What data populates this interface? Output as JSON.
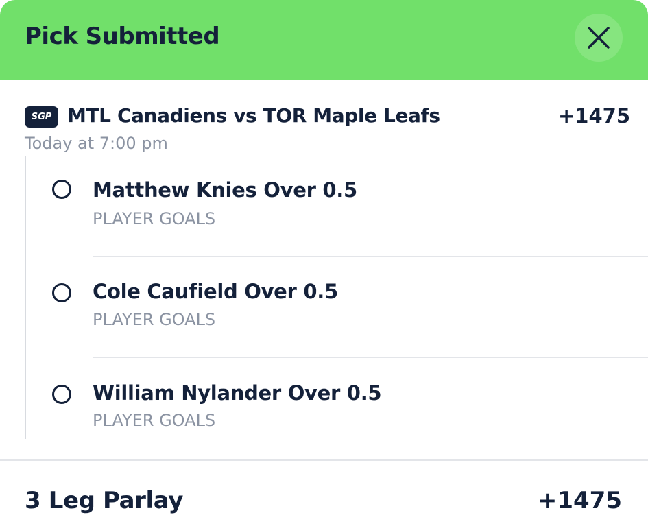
{
  "header": {
    "title": "Pick Submitted",
    "close_icon": "close-icon",
    "background_color": "#71e06a"
  },
  "game": {
    "badge": "SGP",
    "matchup": "MTL Canadiens vs TOR Maple Leafs",
    "odds": "+1475",
    "time": "Today at 7:00 pm"
  },
  "legs": [
    {
      "title": "Matthew Knies Over 0.5",
      "market": "PLAYER GOALS"
    },
    {
      "title": "Cole Caufield Over 0.5",
      "market": "PLAYER GOALS"
    },
    {
      "title": "William Nylander Over 0.5",
      "market": "PLAYER GOALS"
    }
  ],
  "parlay": {
    "label": "3 Leg Parlay",
    "odds": "+1475"
  },
  "colors": {
    "text_primary": "#14213a",
    "text_secondary": "#8b93a2",
    "divider": "#e3e5e9"
  }
}
